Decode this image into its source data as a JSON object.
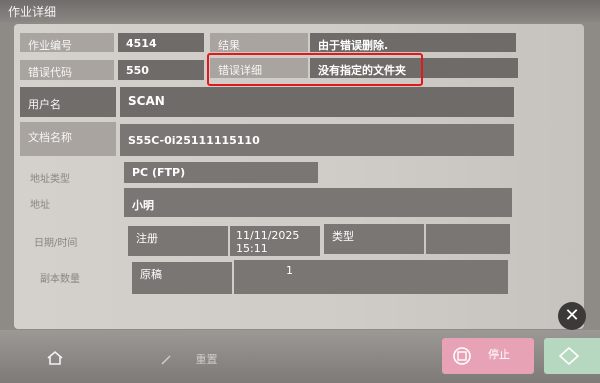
{
  "window": {
    "title": "作业详细"
  },
  "fields": {
    "job_number_label": "作业编号",
    "job_number": "4514",
    "result_label": "结果",
    "result": "由于错误删除.",
    "error_code_label": "错误代码",
    "error_code": "550",
    "error_detail_label": "错误详细",
    "error_detail": "没有指定的文件夹",
    "user_name_label": "用户名",
    "user_name": "SCAN",
    "document_name_label": "文档名称",
    "document_name": "S55C-0i25111115110",
    "address_type_label": "地址类型",
    "address_type": "PC (FTP)",
    "address_label": "地址",
    "address": "小明",
    "datetime_label": "日期/时间",
    "register_label": "注册",
    "date": "11/11/2025",
    "time": "15:11",
    "type_label": "类型",
    "copies_label": "副本数量",
    "original_label": "原稿",
    "copies": "1"
  },
  "footer": {
    "reset_label": "重置",
    "stop_label": "停止"
  },
  "colors": {
    "highlight": "#e0191e",
    "stop": "#e7a2b5",
    "start": "#b7d8c0"
  },
  "icons": [
    "home-icon",
    "reset-icon",
    "stop-icon",
    "start-icon",
    "close-icon"
  ]
}
